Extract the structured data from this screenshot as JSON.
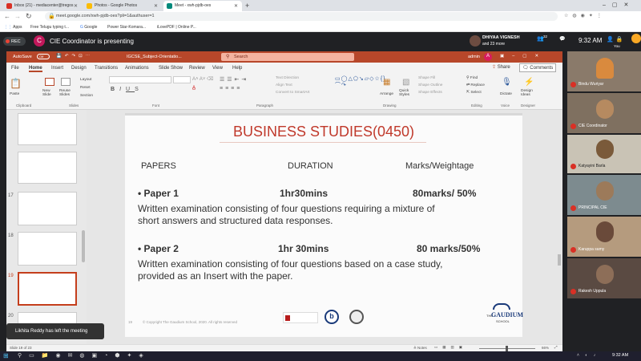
{
  "browser": {
    "tabs": [
      {
        "label": "Inbox (21) - mediacenter@tregos",
        "color": "#d93025"
      },
      {
        "label": "Photos - Google Photos",
        "color": "#fbbc04"
      },
      {
        "label": "Meet - xwh-pjdb-oes",
        "color": "#00897b"
      }
    ],
    "url": "meet.google.com/xwh-pjdb-oes?pli=1&authuser=1",
    "bookmarks": [
      "Apps",
      "Free Telugu typing t...",
      "Google",
      "Power Star-Komara...",
      "iLovePDF | Online P..."
    ]
  },
  "meet": {
    "rec_label": "REC",
    "presenter_initial": "C",
    "presenter_text": "CIE Coordinator is presenting",
    "you_name": "DHIYAA VIGNESH",
    "you_more": "and 23 more",
    "participant_count": "32",
    "time": "9:32 AM",
    "you_label": "You",
    "toast": "Likhita Reddy has left the meeting",
    "participants": [
      {
        "name": "Bindu Wuriyar",
        "bg": "#8a7a6a"
      },
      {
        "name": "CIE Coordinator",
        "bg": "#7f7060"
      },
      {
        "name": "Katyayini Barla",
        "bg": "#c9c3b5"
      },
      {
        "name": "PRINCIPAL CIE",
        "bg": "#7d8b8f"
      },
      {
        "name": "Karuppa samy",
        "bg": "#b59b7e"
      },
      {
        "name": "Rakesh Uppula",
        "bg": "#5a4a42"
      }
    ]
  },
  "ppt": {
    "autosave": "AutoSave",
    "autosave_state": "Off",
    "doc_title": "IGCSE_Subject-Orientatio...",
    "search_placeholder": "Search",
    "user": "admin",
    "menus": [
      "File",
      "Home",
      "Insert",
      "Design",
      "Transitions",
      "Animations",
      "Slide Show",
      "Review",
      "View",
      "Help"
    ],
    "share": "Share",
    "comments": "Comments",
    "ribbon": {
      "paste": "Paste",
      "new_slide": "New Slide",
      "reuse_slides": "Reuse Slides",
      "layout": "Layout",
      "reset": "Reset",
      "section": "Section",
      "text_direction": "Text Direction",
      "align_text": "Align Text",
      "convert_smartart": "Convert to SmartArt",
      "arrange": "Arrange",
      "quick_styles": "Quick Styles",
      "shape_fill": "Shape Fill",
      "shape_outline": "Shape Outline",
      "shape_effects": "Shape Effects",
      "find": "Find",
      "replace": "Replace",
      "select": "Select",
      "dictate": "Dictate",
      "design_ideas": "Design Ideas",
      "groups": [
        "Clipboard",
        "Slides",
        "Font",
        "Paragraph",
        "Drawing",
        "Editing",
        "Voice",
        "Designer"
      ]
    },
    "thumb_numbers": [
      "17",
      "18",
      "19",
      "20"
    ],
    "status_left": "Slide 19 of 23",
    "status_notes": "Notes",
    "status_zoom": "66%",
    "slide": {
      "title": "BUSINESS STUDIES(0450)",
      "col_papers": "PAPERS",
      "col_duration": "DURATION",
      "col_marks": "Marks/Weightage",
      "p1_name": "• Paper 1",
      "p1_duration": "1hr30mins",
      "p1_marks": "80marks/ 50%",
      "p1_desc_1": "Written examination consisting of four questions requiring a mixture of",
      "p1_desc_2": "short answers and structured data responses.",
      "p2_name": "• Paper 2",
      "p2_duration": "1hr 30mins",
      "p2_marks": "80 marks/50%",
      "p2_desc_1": "Written examination consisting of four questions based on a case study,",
      "p2_desc_2": "provided as an Insert with the paper.",
      "footer_num": "19",
      "footer_copy": "© Copyright The Gaudium School, 2020. All rights reserved",
      "logo_text": "GAUDIUM",
      "logo_the": "THE",
      "logo_school": "SCHOOL"
    }
  },
  "taskbar": {
    "time": "9:32 AM"
  },
  "colors": {
    "accent": "#c43e1c",
    "ppt_red": "#b7472a",
    "title_red": "#c0392b"
  }
}
